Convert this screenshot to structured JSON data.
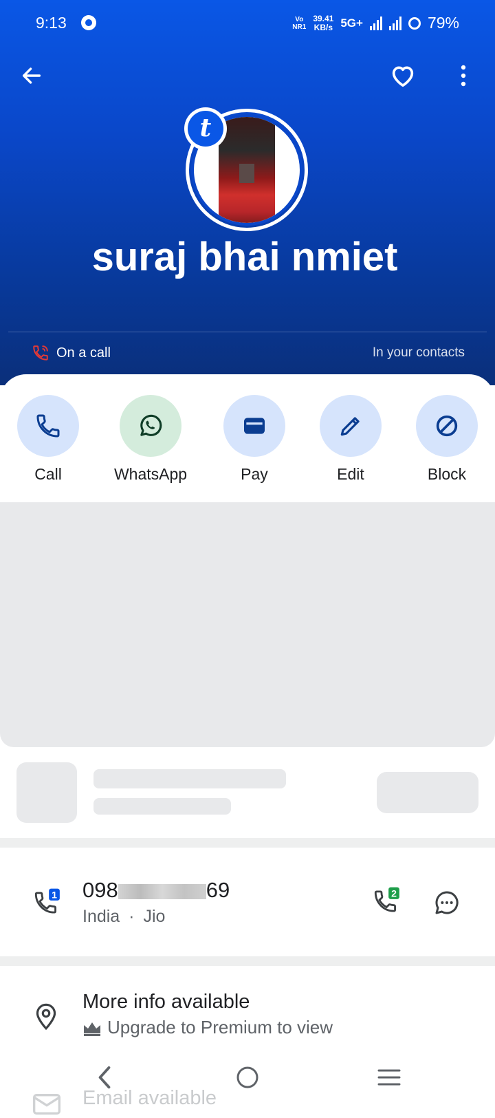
{
  "status_bar": {
    "time": "9:13",
    "volte_top": "Vo",
    "volte_bottom": "NR1",
    "speed_top": "39.41",
    "speed_bottom": "KB/s",
    "network": "5G+",
    "battery": "79%"
  },
  "header": {
    "back_icon": "arrow-left-icon",
    "favorite_icon": "heart-outline-icon",
    "menu_icon": "more-vertical-icon",
    "badge_letter": "t"
  },
  "contact": {
    "name": "suraj bhai nmiet",
    "call_status": "On a call",
    "contact_status": "In your contacts"
  },
  "actions": [
    {
      "label": "Call",
      "icon": "phone-icon"
    },
    {
      "label": "WhatsApp",
      "icon": "whatsapp-icon"
    },
    {
      "label": "Pay",
      "icon": "wallet-icon"
    },
    {
      "label": "Edit",
      "icon": "pencil-icon"
    },
    {
      "label": "Block",
      "icon": "block-icon"
    }
  ],
  "phone": {
    "prefix": "098",
    "suffix": "69",
    "country": "India",
    "separator": "·",
    "carrier": "Jio",
    "sim1": "1",
    "sim2": "2"
  },
  "more_info": {
    "title": "More info available",
    "subtitle": "Upgrade to Premium to view"
  },
  "email": {
    "label": "Email available"
  },
  "colors": {
    "brand": "#0a57e6",
    "action_bg": "#d6e4fc",
    "whatsapp_bg": "#d4ecdc",
    "icon_blue": "#0b3d91",
    "call_red": "#e53935"
  }
}
